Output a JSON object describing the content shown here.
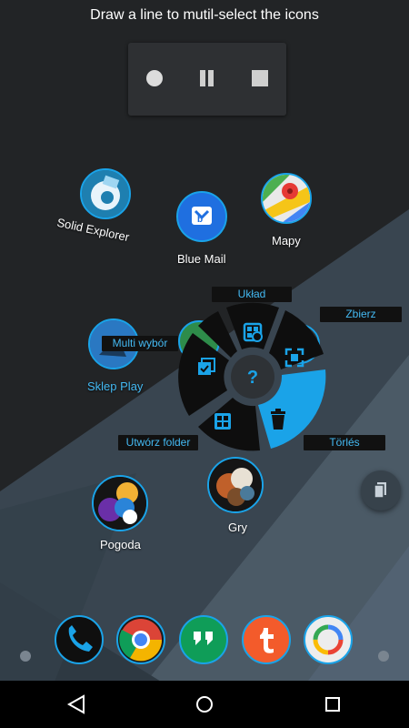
{
  "hint": "Draw a line to mutil-select the icons",
  "recorder": {
    "record": "record-icon",
    "pause": "pause-icon",
    "stop": "stop-icon"
  },
  "apps": {
    "solid_explorer": "Solid Explorer",
    "blue_mail": "Blue Mail",
    "mapy": "Mapy",
    "sklep_play": "Sklep Play",
    "pogoda": "Pogoda",
    "gry": "Gry"
  },
  "pie_menu": {
    "uklad": "Układ",
    "zbierz": "Zbierz",
    "multi_wybor": "Multi wybór",
    "utworz_folder": "Utwórz folder",
    "torles": "Törlés",
    "center": "?"
  },
  "dock": [
    "phone-icon",
    "chrome-icon",
    "hangouts-icon",
    "tumblr-icon",
    "photos-icon"
  ],
  "navbar": {
    "back": "back-icon",
    "home": "home-icon",
    "recents": "recents-icon"
  },
  "colors": {
    "accent": "#1aa3e8",
    "accent_text": "#44b9f2",
    "menu_bg": "#111111"
  }
}
